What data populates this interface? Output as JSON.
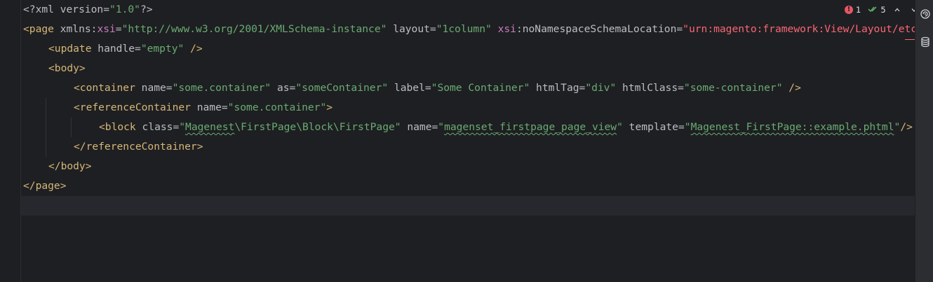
{
  "editor": {
    "lines": [
      [
        {
          "c": "t-pi",
          "t": "<?xml version="
        },
        {
          "c": "t-str",
          "t": "\"1.0\""
        },
        {
          "c": "t-pi",
          "t": "?>"
        }
      ],
      [
        {
          "c": "t-tag",
          "t": "<page "
        },
        {
          "c": "t-attr",
          "t": "xmlns:"
        },
        {
          "c": "t-ns",
          "t": "xsi"
        },
        {
          "c": "t-attr",
          "t": "="
        },
        {
          "c": "t-str",
          "t": "\"http://www.w3.org/2001/XMLSchema-instance\""
        },
        {
          "c": "t-attr",
          "t": " layout="
        },
        {
          "c": "t-str",
          "t": "\"1column\""
        },
        {
          "c": "t-attr",
          "t": " "
        },
        {
          "c": "t-ns",
          "t": "xsi"
        },
        {
          "c": "t-attr",
          "t": ":noNamespaceSchemaLocation="
        },
        {
          "c": "t-red",
          "t": "\"urn:magento:framework:View/Layout/etc/page_configuration.xsd\""
        },
        {
          "c": "t-tag",
          "t": ">"
        }
      ],
      [
        {
          "c": "t-tag",
          "t": "<update "
        },
        {
          "c": "t-attr",
          "t": "handle="
        },
        {
          "c": "t-str",
          "t": "\"empty\""
        },
        {
          "c": "t-tag",
          "t": " />"
        }
      ],
      [
        {
          "c": "t-tag",
          "t": "<body>"
        }
      ],
      [
        {
          "c": "t-tag",
          "t": "<container "
        },
        {
          "c": "t-attr",
          "t": "name="
        },
        {
          "c": "t-str",
          "t": "\"some.container\""
        },
        {
          "c": "t-attr",
          "t": " as="
        },
        {
          "c": "t-str",
          "t": "\"someContainer\""
        },
        {
          "c": "t-attr",
          "t": " label="
        },
        {
          "c": "t-str",
          "t": "\"Some Container\""
        },
        {
          "c": "t-attr",
          "t": " htmlTag="
        },
        {
          "c": "t-str",
          "t": "\"div\""
        },
        {
          "c": "t-attr",
          "t": " htmlClass="
        },
        {
          "c": "t-str",
          "t": "\"some-container\""
        },
        {
          "c": "t-tag",
          "t": " />"
        }
      ],
      [
        {
          "c": "t-tag",
          "t": "<referenceContainer "
        },
        {
          "c": "t-attr",
          "t": "name="
        },
        {
          "c": "t-str",
          "t": "\"some.container\""
        },
        {
          "c": "t-tag",
          "t": ">"
        }
      ],
      [
        {
          "c": "t-tag",
          "t": "<block "
        },
        {
          "c": "t-attr",
          "t": "class="
        },
        {
          "c": "t-str",
          "t": "\""
        },
        {
          "c": "t-str squiggle",
          "t": "Magenest"
        },
        {
          "c": "t-str",
          "t": "\\FirstPage\\Block\\FirstPage\""
        },
        {
          "c": "t-attr",
          "t": " name="
        },
        {
          "c": "t-str",
          "t": "\""
        },
        {
          "c": "t-str squiggle",
          "t": "magenset_firstpage_page_view"
        },
        {
          "c": "t-str",
          "t": "\""
        },
        {
          "c": "t-attr",
          "t": " template="
        },
        {
          "c": "t-str",
          "t": "\""
        },
        {
          "c": "t-str squiggle",
          "t": "Magenest_FirstPage::example.phtml"
        },
        {
          "c": "t-str",
          "t": "\""
        },
        {
          "c": "t-tag",
          "t": "/>"
        }
      ],
      [
        {
          "c": "t-tag",
          "t": "</referenceContainer>"
        }
      ],
      [
        {
          "c": "t-tag",
          "t": "</body>"
        }
      ],
      [
        {
          "c": "t-tag",
          "t": "</page>"
        }
      ],
      []
    ]
  },
  "inspections": {
    "error_count": "1",
    "ok_count": "5",
    "error_icon": "error-circle-icon",
    "ok_icon": "double-check-icon"
  },
  "toolbar": {
    "items": [
      "ai-assistant-icon",
      "database-icon"
    ]
  },
  "colors": {
    "background": "#1e1f22",
    "tag": "#d5b778",
    "string": "#6aab73",
    "namespace": "#c77dbb",
    "error": "#fa6675"
  }
}
